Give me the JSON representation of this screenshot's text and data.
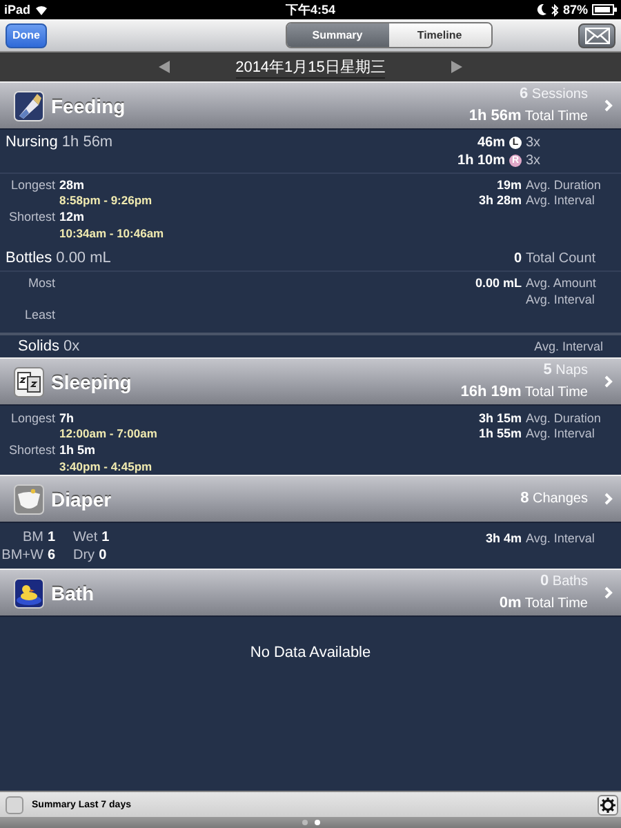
{
  "status_bar": {
    "device": "iPad",
    "time": "下午4:54",
    "battery": "87%"
  },
  "nav": {
    "done": "Done",
    "tabs": [
      {
        "label": "Summary",
        "selected": true
      },
      {
        "label": "Timeline",
        "selected": false
      }
    ]
  },
  "date": "2014年1月15日星期三",
  "sections": [
    {
      "kind": "feeding",
      "title": "Feeding",
      "stats": [
        "**6** Sessions",
        "**1h 56m** Total Time"
      ],
      "blocks": [
        {
          "head": {
            "label": "Nursing",
            "value": "1h 56m",
            "right": [
              {
                "value": "46m",
                "badge": "L",
                "color": "#ffffff",
                "count": "3x"
              },
              {
                "value": "1h 10m",
                "badge": "R",
                "color": "#e0a8c8",
                "count": "3x"
              }
            ]
          },
          "lines": [
            {
              "kind": "stat",
              "label": "Longest",
              "value": "28m",
              "right": {
                "value": "19m",
                "label": "Avg. Duration"
              }
            },
            {
              "kind": "time",
              "value": "8:58pm - 9:26pm",
              "right": {
                "value": "3h 28m",
                "label": "Avg. Interval"
              }
            },
            {
              "kind": "stat",
              "label": "Shortest",
              "value": "12m"
            },
            {
              "kind": "time",
              "value": "10:34am - 10:46am"
            }
          ]
        },
        {
          "head": {
            "label": "Bottles",
            "value": "0.00 mL",
            "right": [
              {
                "value": "0",
                "label": "Total Count"
              }
            ]
          },
          "lines": [
            {
              "kind": "stat",
              "label": "Most",
              "right": {
                "value": "0.00 mL",
                "label": "Avg. Amount"
              }
            },
            {
              "kind": "stat",
              "right": {
                "label": "Avg. Interval"
              }
            },
            {
              "kind": "stat",
              "label": "Least"
            }
          ]
        }
      ],
      "footer": {
        "label": "Solids",
        "value": "0x",
        "right": {
          "label": "Avg. Interval"
        }
      }
    },
    {
      "kind": "sleeping",
      "title": "Sleeping",
      "stats": [
        "**5** Naps",
        "**16h 19m** Total Time"
      ],
      "blocks": [
        {
          "lines": [
            {
              "kind": "stat",
              "label": "Longest",
              "value": "7h",
              "right": {
                "value": "3h 15m",
                "label": "Avg. Duration"
              }
            },
            {
              "kind": "time",
              "value": "12:00am - 7:00am",
              "right": {
                "value": "1h 55m",
                "label": "Avg. Interval"
              }
            },
            {
              "kind": "stat",
              "label": "Shortest",
              "value": "1h 5m"
            },
            {
              "kind": "time",
              "value": "3:40pm - 4:45pm"
            }
          ]
        }
      ]
    },
    {
      "kind": "diaper",
      "title": "Diaper",
      "stats": [
        "**8** Changes"
      ],
      "blocks": [
        {
          "lines": [
            {
              "kind": "pairs",
              "items": [
                {
                  "label": "BM",
                  "value": "1"
                },
                {
                  "label": "Wet",
                  "value": "1"
                }
              ],
              "right": {
                "value": "3h 4m",
                "label": "Avg. Interval"
              }
            },
            {
              "kind": "pairs",
              "items": [
                {
                  "label": "BM+W",
                  "value": "6"
                },
                {
                  "label": "Dry",
                  "value": "0"
                }
              ]
            }
          ]
        }
      ]
    },
    {
      "kind": "bath",
      "title": "Bath",
      "stats": [
        "**0** Baths",
        "**0m** Total Time"
      ],
      "empty": "No Data Available"
    }
  ],
  "toolbar": {
    "label": "Summary Last 7 days",
    "checked": false
  },
  "page_dots": [
    {
      "selected": false
    },
    {
      "selected": true
    }
  ]
}
